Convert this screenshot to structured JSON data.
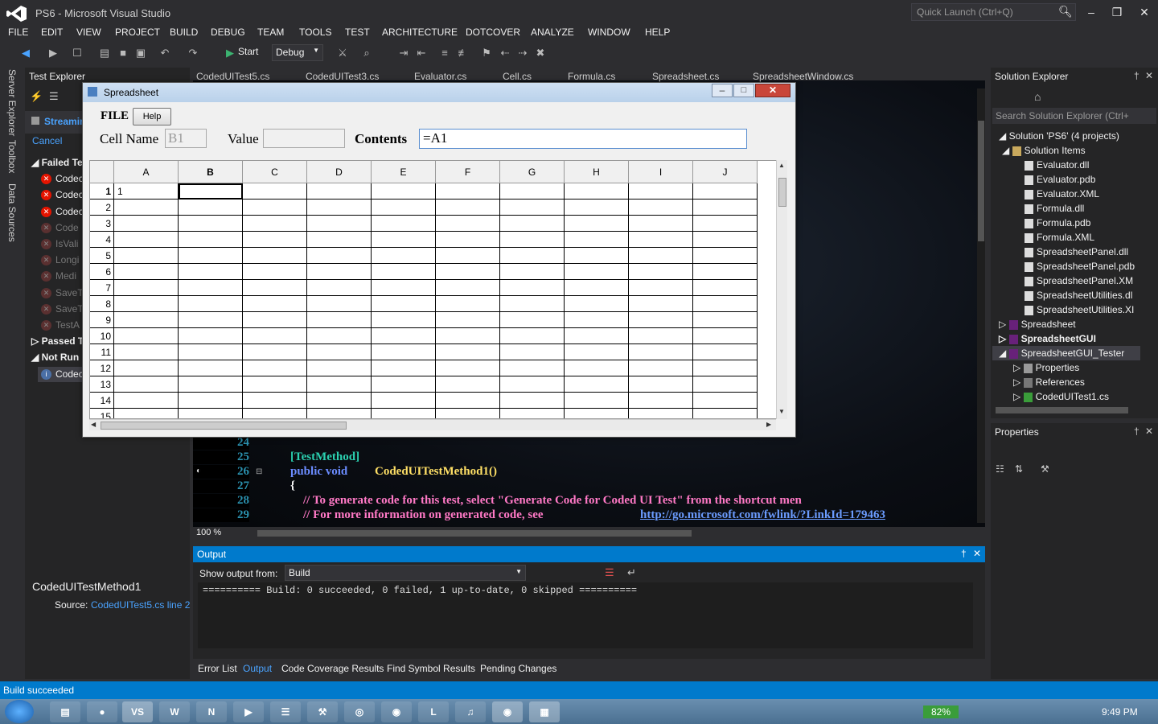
{
  "window": {
    "title": "PS6 - Microsoft Visual Studio",
    "quick_launch_placeholder": "Quick Launch (Ctrl+Q)"
  },
  "menu": [
    "FILE",
    "EDIT",
    "VIEW",
    "PROJECT",
    "BUILD",
    "DEBUG",
    "TEAM",
    "TOOLS",
    "TEST",
    "ARCHITECTURE",
    "DOTCOVER",
    "ANALYZE",
    "WINDOW",
    "HELP"
  ],
  "toolbar": {
    "start_label": "Start",
    "config": "Debug"
  },
  "left_strip": [
    "Server Explorer",
    "Toolbox",
    "Data Sources"
  ],
  "test_explorer": {
    "title": "Test Explorer",
    "streaming": "Streamin",
    "cancel": "Cancel",
    "groups": {
      "failed": "Failed Te",
      "passed": "Passed T",
      "notrun": "Not Run"
    },
    "failed_tests": [
      "Codec",
      "Codec",
      "Codec",
      "Code",
      "IsVali",
      "Longi",
      "Medi",
      "SaveT",
      "SaveT",
      "TestA"
    ],
    "notrun_tests": [
      "Codec"
    ],
    "detail_title": "CodedUITestMethod1",
    "detail_source_label": "Source:",
    "detail_source_link": "CodedUITest5.cs line 2"
  },
  "editor": {
    "tabs": [
      "CodedUITest5.cs",
      "CodedUITest3.cs",
      "Evaluator.cs",
      "Cell.cs",
      "Formula.cs",
      "Spreadsheet.cs",
      "SpreadsheetWindow.cs"
    ],
    "line_numbers": [
      "24",
      "25",
      "26",
      "27",
      "28",
      "29"
    ],
    "code": {
      "l25": "[TestMethod]",
      "l26a": "public void ",
      "l26b": "CodedUITestMethod1()",
      "l27": "{",
      "l28": "// To generate code for this test, select \"Generate Code for Coded UI Test\" from the shortcut men",
      "l29a": "// For more information on generated code, see ",
      "l29b": "http://go.microsoft.com/fwlink/?LinkId=179463"
    },
    "zoom": "100 %"
  },
  "output": {
    "title": "Output",
    "show_from_label": "Show output from:",
    "source": "Build",
    "text": "========== Build: 0 succeeded, 0 failed, 1 up-to-date, 0 skipped =========="
  },
  "bottom_tabs": [
    "Error List",
    "Output",
    "Code Coverage Results",
    "Find Symbol Results",
    "Pending Changes"
  ],
  "solution_explorer": {
    "title": "Solution Explorer",
    "search_placeholder": "Search Solution Explorer (Ctrl+",
    "solution": "Solution 'PS6' (4 projects)",
    "solution_items": "Solution Items",
    "files": [
      "Evaluator.dll",
      "Evaluator.pdb",
      "Evaluator.XML",
      "Formula.dll",
      "Formula.pdb",
      "Formula.XML",
      "SpreadsheetPanel.dll",
      "SpreadsheetPanel.pdb",
      "SpreadsheetPanel.XM",
      "SpreadsheetUtilities.dl",
      "SpreadsheetUtilities.XI"
    ],
    "projects": [
      "Spreadsheet",
      "SpreadsheetGUI",
      "SpreadsheetGUI_Tester"
    ],
    "tester_children": [
      "Properties",
      "References",
      "CodedUITest1.cs"
    ]
  },
  "properties": {
    "title": "Properties"
  },
  "status": {
    "text": "Build succeeded"
  },
  "taskbar": {
    "battery": "82%",
    "clock": "9:49 PM"
  },
  "spreadsheet": {
    "title": "Spreadsheet",
    "menu_file": "FILE",
    "help_button": "Help",
    "cell_name_label": "Cell Name",
    "cell_name_value": "B1",
    "value_label": "Value",
    "value_value": "",
    "contents_label": "Contents",
    "contents_value": "=A1",
    "columns": [
      "A",
      "B",
      "C",
      "D",
      "E",
      "F",
      "G",
      "H",
      "I",
      "J"
    ],
    "rows": [
      "1",
      "2",
      "3",
      "4",
      "5",
      "6",
      "7",
      "8",
      "9",
      "10",
      "11",
      "12",
      "13",
      "14",
      "15"
    ],
    "cell_a1": "1",
    "selected_cell": "B1"
  }
}
